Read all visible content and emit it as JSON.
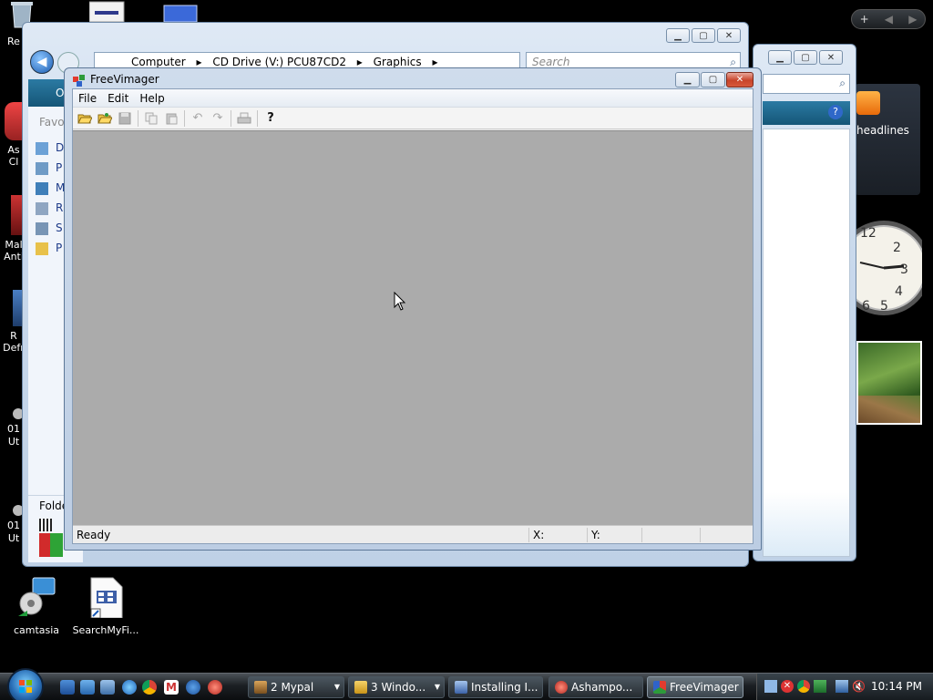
{
  "desktop": {
    "icons": [
      {
        "label": "Re",
        "icon": "recycle-bin-icon"
      },
      {
        "label": "As\nCl",
        "icon": "app-icon"
      },
      {
        "label": "Mal\nAnti",
        "icon": "app-icon"
      },
      {
        "label": "R\nDefr",
        "icon": "app-icon"
      },
      {
        "label": "01\nUt",
        "icon": "app-icon"
      },
      {
        "label": "01\nUt",
        "icon": "app-icon"
      },
      {
        "label": "camtasia",
        "icon": "camtasia-icon"
      },
      {
        "label": "SearchMyFi...",
        "icon": "document-icon"
      }
    ]
  },
  "explorer": {
    "breadcrumb": [
      "Computer",
      "CD Drive (V:) PCU87CD2",
      "Graphics"
    ],
    "search_placeholder": "Search",
    "organize_label": "O",
    "favorites_label": "Favo",
    "nav_items": [
      "D",
      "P",
      "M",
      "R",
      "S",
      "P"
    ],
    "folders_label": "Folde"
  },
  "ie_window": {
    "headlines_label": "headlines"
  },
  "freevimager": {
    "title": "FreeVimager",
    "menu": [
      "File",
      "Edit",
      "Help"
    ],
    "toolbar": [
      {
        "icon": "open-folder-icon",
        "enabled": true
      },
      {
        "icon": "open-image-icon",
        "enabled": true
      },
      {
        "icon": "save-icon",
        "enabled": false
      },
      {
        "icon": "copy-icon",
        "enabled": false
      },
      {
        "icon": "paste-icon",
        "enabled": false
      },
      {
        "icon": "undo-icon",
        "enabled": false
      },
      {
        "icon": "redo-icon",
        "enabled": false
      },
      {
        "icon": "print-icon",
        "enabled": false
      },
      {
        "icon": "help-icon",
        "enabled": true
      }
    ],
    "status": {
      "text": "Ready",
      "x_label": "X:",
      "y_label": "Y:"
    },
    "canvas_color": "#ababab"
  },
  "sidebar": {
    "add_label": "+",
    "clock": {
      "numbers": [
        "12",
        "2",
        "3",
        "4",
        "5",
        "6"
      ]
    }
  },
  "taskbar": {
    "buttons": [
      {
        "label": "2 Mypal",
        "icon": "mypal-icon",
        "has_menu": true
      },
      {
        "label": "3 Windo...",
        "icon": "folder-icon",
        "has_menu": true
      },
      {
        "label": "Installing I...",
        "icon": "installer-icon",
        "has_menu": false
      },
      {
        "label": "Ashampo...",
        "icon": "ashampoo-icon",
        "has_menu": false
      },
      {
        "label": "FreeVimager",
        "icon": "freevimager-icon",
        "has_menu": false,
        "active": true
      }
    ],
    "clock": "10:14 PM"
  }
}
